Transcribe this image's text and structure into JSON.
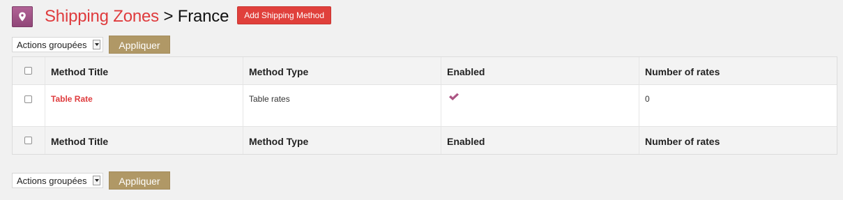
{
  "header": {
    "icon": "map-pin-icon",
    "breadcrumb_link": "Shipping Zones",
    "separator": ">",
    "zone_name": "France",
    "add_button_label": "Add Shipping Method"
  },
  "bulk_actions": {
    "selected": "Actions groupées",
    "apply_label": "Appliquer"
  },
  "table": {
    "columns": [
      "Method Title",
      "Method Type",
      "Enabled",
      "Number of rates"
    ],
    "rows": [
      {
        "title": "Table Rate",
        "type": "Table rates",
        "enabled": true,
        "rates": "0"
      }
    ]
  },
  "colors": {
    "accent_red": "#df3b3d",
    "button_red": "#e0403b",
    "apply_brown": "#b09866",
    "check_purple": "#a8517f"
  }
}
